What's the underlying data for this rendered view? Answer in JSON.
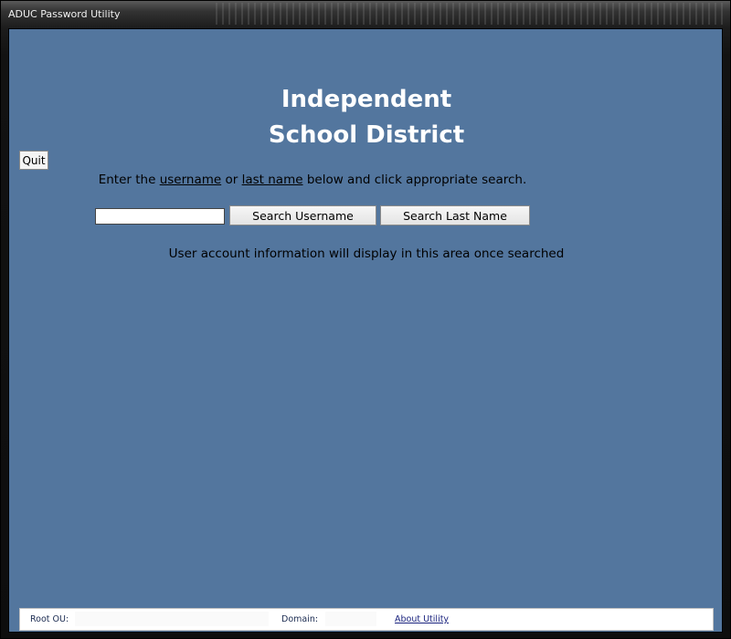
{
  "window": {
    "title": "ADUC Password Utility"
  },
  "header": {
    "line1": "Independent",
    "line2": "School District"
  },
  "toolbar": {
    "quit_label": "Quit"
  },
  "instructions": {
    "prefix": "Enter the ",
    "username_word": "username",
    "or_word": " or ",
    "lastname_word": "last name",
    "suffix": " below and click appropriate search."
  },
  "search": {
    "value": "",
    "placeholder": "",
    "username_button": "Search Username",
    "lastname_button": "Search Last Name"
  },
  "result": {
    "message": "User account information will display in this area once searched"
  },
  "statusbar": {
    "root_ou_label": "Root OU:",
    "root_ou_value": "",
    "domain_label": "Domain:",
    "domain_value": "",
    "about_link": "About Utility"
  },
  "colors": {
    "client_background": "#53769e",
    "heading_text": "#ffffff",
    "link": "#1a237e"
  }
}
